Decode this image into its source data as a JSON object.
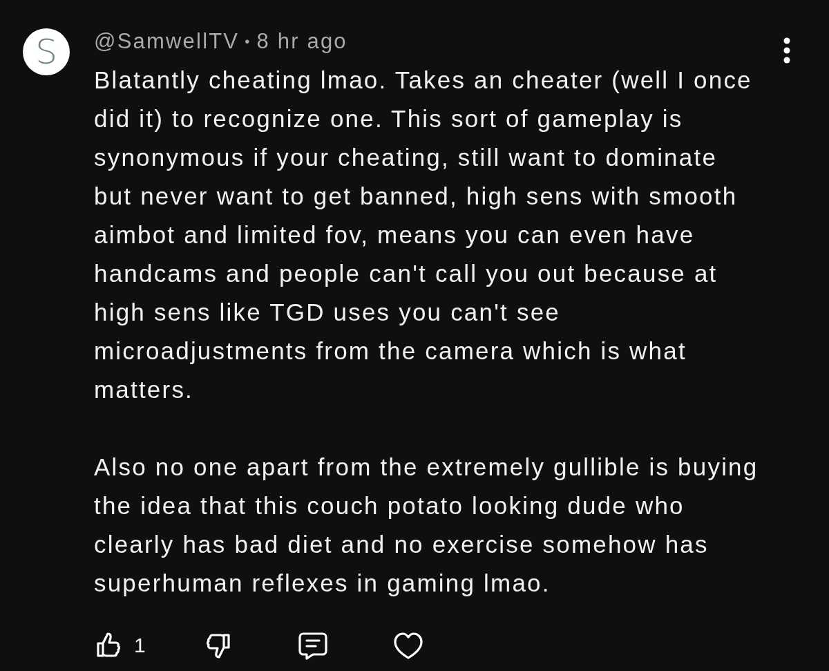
{
  "comment": {
    "avatar": {
      "letter": "S"
    },
    "author": "@SamwellTV",
    "separator": "•",
    "time": "8 hr ago",
    "paragraphs": [
      "Blatantly cheating lmao. Takes an cheater (well I once did it) to recognize one. This sort of gameplay is synonymous if your cheating, still want to dominate but never want to get banned, high sens with smooth aimbot and limited fov, means you can even have handcams and people can't call you out because at high sens like TGD uses you can't see microadjustments from the camera which is what matters.",
      "Also no one apart from the extremely gullible is buying the idea that this couch potato looking dude who clearly has bad diet and no exercise somehow has superhuman reflexes in gaming lmao."
    ],
    "actions": [
      {
        "kind": "like",
        "count": "1"
      },
      {
        "kind": "dislike"
      },
      {
        "kind": "reply"
      },
      {
        "kind": "heart"
      }
    ]
  }
}
